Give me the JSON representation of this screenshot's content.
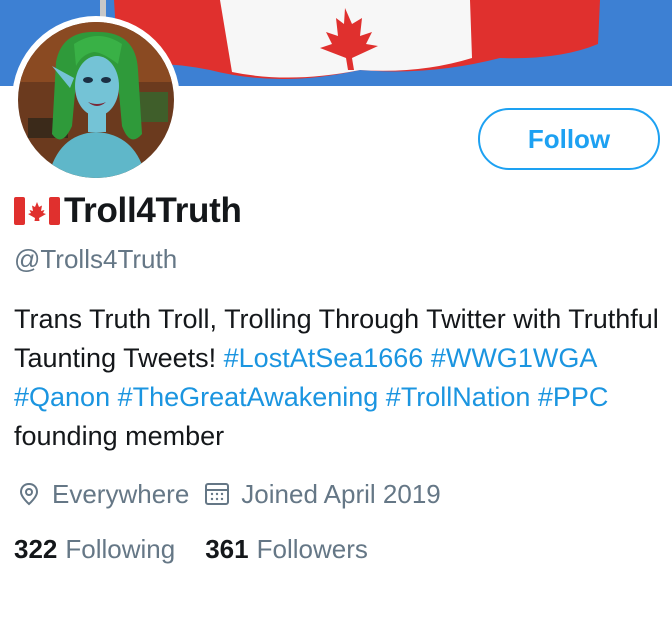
{
  "profile": {
    "display_name": "Troll4Truth",
    "handle": "@Trolls4Truth",
    "follow_label": "Follow",
    "flag_icon": "canada-flag-icon",
    "bio": {
      "text_1": "Trans Truth Troll, Trolling Through Twitter with Truthful Taunting Tweets! ",
      "hashtags_1": [
        "#LostAtSea1666",
        "#WWG1WGA",
        "#Qanon",
        "#TheGreatAwakening",
        "#TrollNation",
        "#PPC"
      ],
      "text_2": " founding member"
    },
    "location": "Everywhere",
    "location_icon": "location-pin-icon",
    "joined": "Joined April 2019",
    "joined_icon": "calendar-icon",
    "following_count": "322",
    "following_label": "Following",
    "followers_count": "361",
    "followers_label": "Followers"
  },
  "colors": {
    "accent": "#1da1f2",
    "link": "#1b95e0",
    "muted": "#657786",
    "text": "#14171a"
  }
}
